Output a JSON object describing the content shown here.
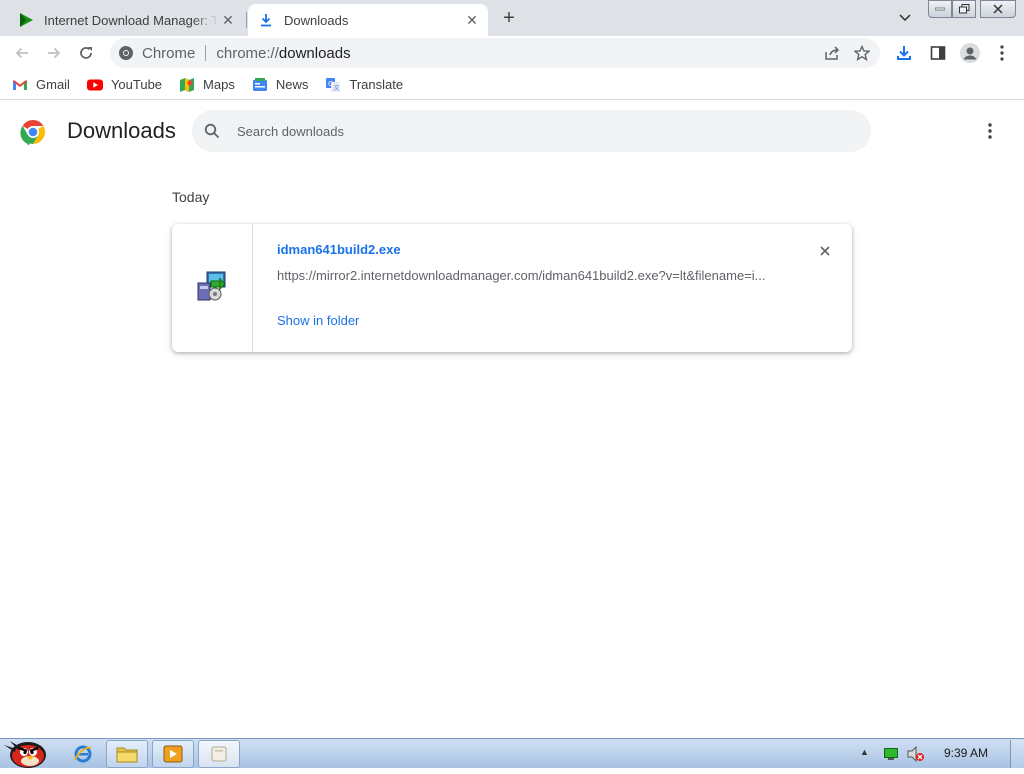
{
  "browser": {
    "tabs": [
      {
        "title": "Internet Download Manager: The fastest download accelerator",
        "active": false,
        "icon": "idm-play-icon"
      },
      {
        "title": "Downloads",
        "active": true,
        "icon": "download-icon"
      }
    ],
    "address": {
      "site_chip": "Chrome",
      "url_scheme": "chrome://",
      "url_path": "downloads"
    },
    "bookmarks": [
      {
        "label": "Gmail",
        "icon": "gmail-icon"
      },
      {
        "label": "YouTube",
        "icon": "youtube-icon"
      },
      {
        "label": "Maps",
        "icon": "maps-icon"
      },
      {
        "label": "News",
        "icon": "news-icon"
      },
      {
        "label": "Translate",
        "icon": "translate-icon"
      }
    ]
  },
  "downloads_page": {
    "title": "Downloads",
    "search_placeholder": "Search downloads",
    "date_heading": "Today",
    "items": [
      {
        "file_name": "idman641build2.exe",
        "url": "https://mirror2.internetdownloadmanager.com/idman641build2.exe?v=lt&filename=i...",
        "action": "Show in folder"
      }
    ]
  },
  "taskbar": {
    "clock": "9:39 AM"
  },
  "colors": {
    "accent": "#1a73e8",
    "tab_strip": "#dee1e6",
    "omnibox": "#f1f3f4"
  }
}
